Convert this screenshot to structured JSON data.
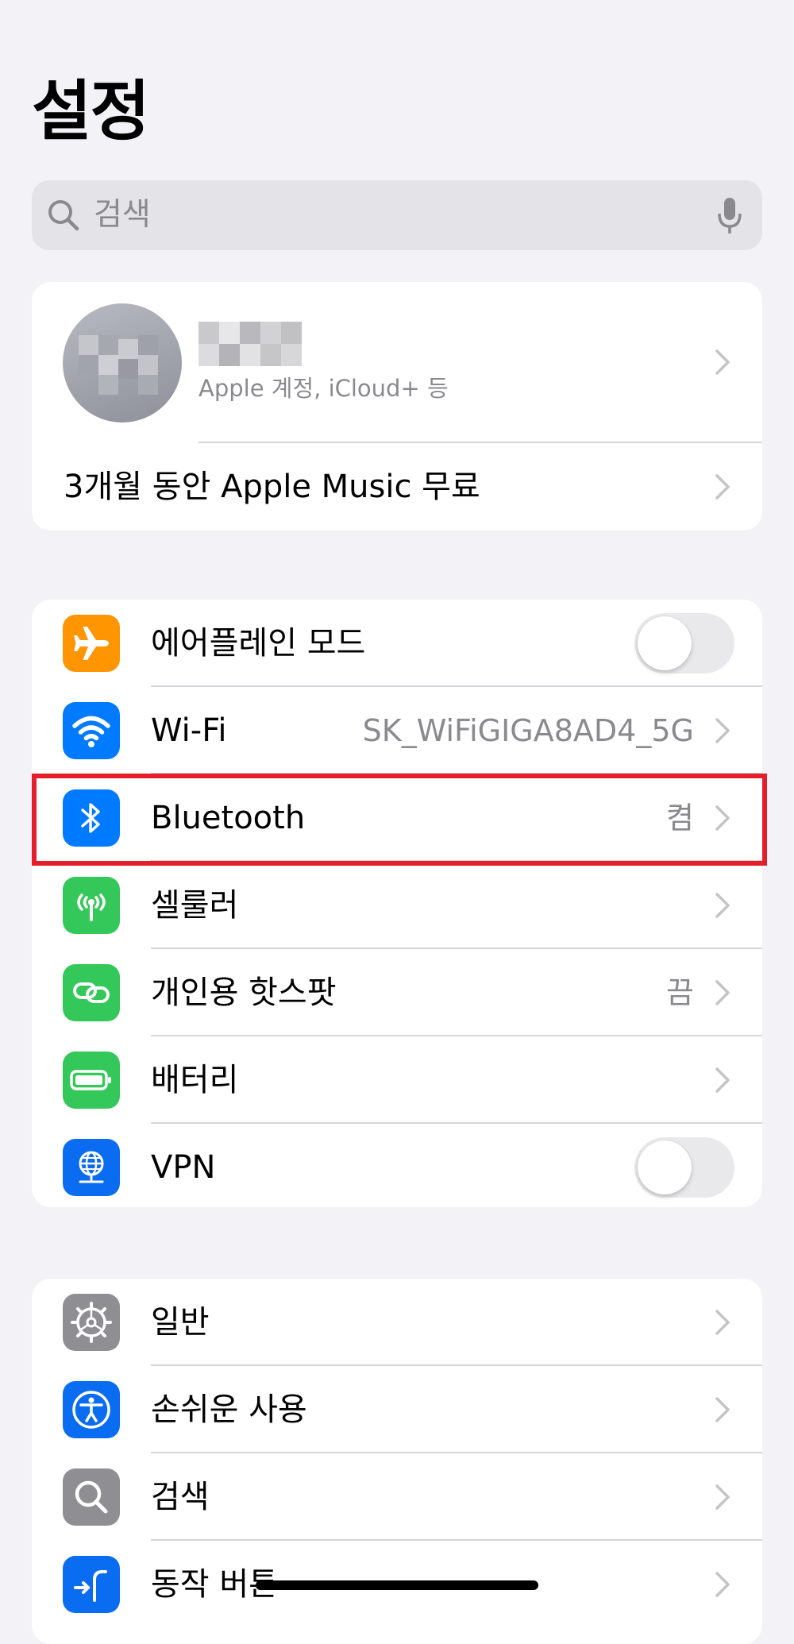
{
  "header": {
    "title": "설정"
  },
  "search": {
    "placeholder": "검색",
    "icon": "magnifier-icon",
    "mic_icon": "microphone-icon"
  },
  "profile": {
    "subtitle": "Apple 계정, iCloud+ 등",
    "promo": "3개월 동안 Apple Music 무료"
  },
  "connectivity": [
    {
      "label": "에어플레인 모드",
      "icon": "airplane-icon",
      "color": "#ff9500",
      "control": "toggle",
      "on": false
    },
    {
      "label": "Wi-Fi",
      "icon": "wifi-icon",
      "color": "#007aff",
      "value": "SK_WiFiGIGA8AD4_5G"
    },
    {
      "label": "Bluetooth",
      "icon": "bluetooth-icon",
      "color": "#007aff",
      "value": "켬",
      "highlighted": true
    },
    {
      "label": "셀룰러",
      "icon": "antenna-icon",
      "color": "#34c759"
    },
    {
      "label": "개인용 핫스팟",
      "icon": "hotspot-link-icon",
      "color": "#34c759",
      "value": "끔"
    },
    {
      "label": "배터리",
      "icon": "battery-icon",
      "color": "#34c759"
    },
    {
      "label": "VPN",
      "icon": "vpn-globe-icon",
      "color": "#0a6cf0",
      "control": "toggle",
      "on": false
    }
  ],
  "system": [
    {
      "label": "일반",
      "icon": "gear-icon",
      "color": "#8e8e93"
    },
    {
      "label": "손쉬운 사용",
      "icon": "accessibility-icon",
      "color": "#0a6cf0"
    },
    {
      "label": "검색",
      "icon": "search-icon",
      "color": "#8e8e93"
    },
    {
      "label": "동작 버튼",
      "icon": "action-button-icon",
      "color": "#0a6cf0"
    }
  ],
  "colors": {
    "highlight": "#e41e2b",
    "background": "#f2f2f7",
    "secondary_text": "#8a8a8e"
  }
}
